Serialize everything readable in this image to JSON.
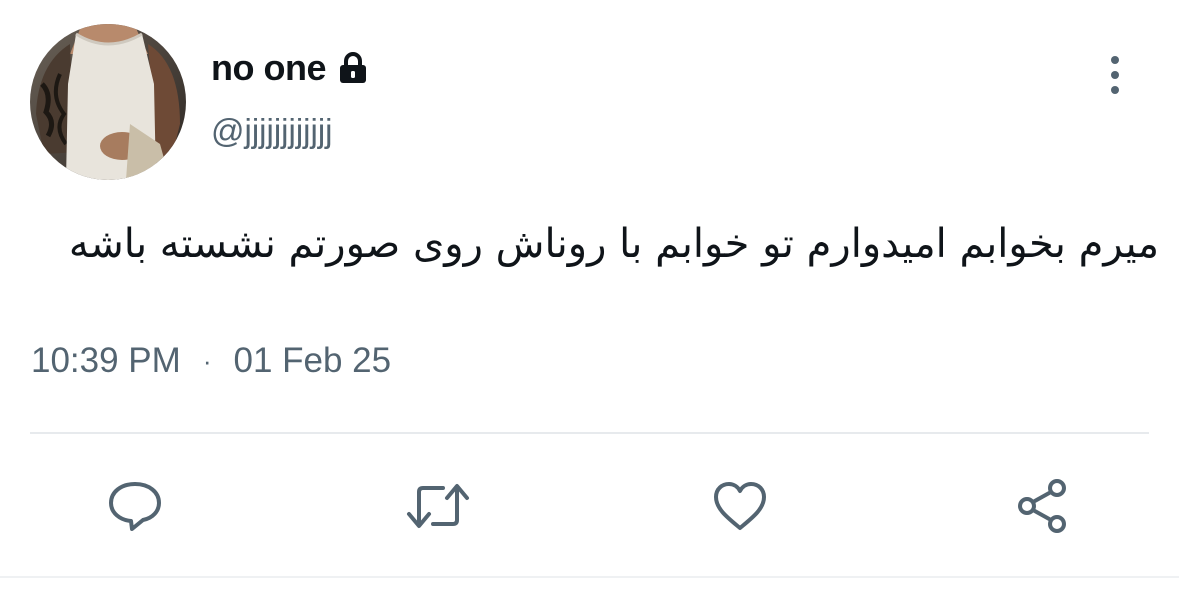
{
  "user": {
    "display_name": "no one",
    "handle": "@jjjjjjjjjjjj",
    "protected_icon": "lock-icon",
    "avatar_icon": "profile-avatar"
  },
  "tweet": {
    "text": "میرم بخوابم امیدوارم تو خوابم با روناش روی صورتم نشسته باشه",
    "time": "10:39 PM",
    "separator": "·",
    "date": "01 Feb 25"
  },
  "actions": {
    "reply_icon": "reply-icon",
    "retweet_icon": "retweet-icon",
    "like_icon": "heart-icon",
    "share_icon": "share-icon",
    "more_icon": "more-vertical-icon"
  },
  "colors": {
    "text_primary": "#0f1419",
    "text_secondary": "#536471",
    "icon": "#536471",
    "divider": "#e7eaed"
  }
}
